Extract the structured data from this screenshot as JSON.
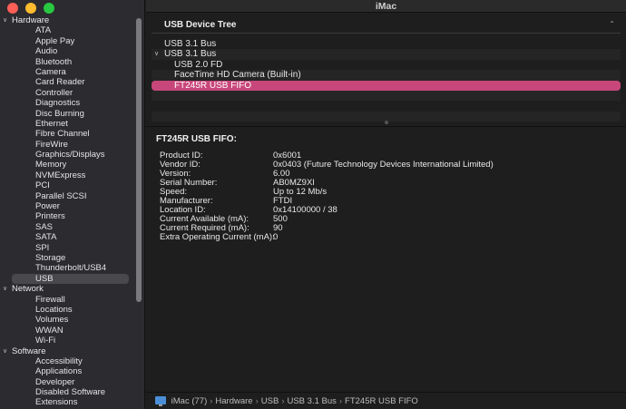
{
  "window": {
    "title": "iMac"
  },
  "sidebar": {
    "rows": [
      {
        "kind": "group",
        "label": "Hardware"
      },
      {
        "kind": "item",
        "label": "ATA"
      },
      {
        "kind": "item",
        "label": "Apple Pay"
      },
      {
        "kind": "item",
        "label": "Audio"
      },
      {
        "kind": "item",
        "label": "Bluetooth"
      },
      {
        "kind": "item",
        "label": "Camera"
      },
      {
        "kind": "item",
        "label": "Card Reader"
      },
      {
        "kind": "item",
        "label": "Controller"
      },
      {
        "kind": "item",
        "label": "Diagnostics"
      },
      {
        "kind": "item",
        "label": "Disc Burning"
      },
      {
        "kind": "item",
        "label": "Ethernet"
      },
      {
        "kind": "item",
        "label": "Fibre Channel"
      },
      {
        "kind": "item",
        "label": "FireWire"
      },
      {
        "kind": "item",
        "label": "Graphics/Displays"
      },
      {
        "kind": "item",
        "label": "Memory"
      },
      {
        "kind": "item",
        "label": "NVMExpress"
      },
      {
        "kind": "item",
        "label": "PCI"
      },
      {
        "kind": "item",
        "label": "Parallel SCSI"
      },
      {
        "kind": "item",
        "label": "Power"
      },
      {
        "kind": "item",
        "label": "Printers"
      },
      {
        "kind": "item",
        "label": "SAS"
      },
      {
        "kind": "item",
        "label": "SATA"
      },
      {
        "kind": "item",
        "label": "SPI"
      },
      {
        "kind": "item",
        "label": "Storage"
      },
      {
        "kind": "item",
        "label": "Thunderbolt/USB4"
      },
      {
        "kind": "item",
        "label": "USB",
        "selected": true
      },
      {
        "kind": "group",
        "label": "Network"
      },
      {
        "kind": "item",
        "label": "Firewall"
      },
      {
        "kind": "item",
        "label": "Locations"
      },
      {
        "kind": "item",
        "label": "Volumes"
      },
      {
        "kind": "item",
        "label": "WWAN"
      },
      {
        "kind": "item",
        "label": "Wi-Fi"
      },
      {
        "kind": "group",
        "label": "Software"
      },
      {
        "kind": "item",
        "label": "Accessibility"
      },
      {
        "kind": "item",
        "label": "Applications"
      },
      {
        "kind": "item",
        "label": "Developer"
      },
      {
        "kind": "item",
        "label": "Disabled Software"
      },
      {
        "kind": "item",
        "label": "Extensions"
      }
    ]
  },
  "tree": {
    "header": "USB Device Tree",
    "rows": [
      {
        "level": 0,
        "label": "USB 3.1 Bus",
        "expanded": false
      },
      {
        "level": 0,
        "label": "USB 3.1 Bus",
        "expanded": true
      },
      {
        "level": 1,
        "label": "USB 2.0 FD"
      },
      {
        "level": 1,
        "label": "FaceTime HD Camera (Built-in)"
      },
      {
        "level": 1,
        "label": "FT245R USB FIFO",
        "selected": true
      }
    ]
  },
  "detail": {
    "title": "FT245R USB FIFO:",
    "properties": [
      {
        "key": "Product ID:",
        "value": "0x6001"
      },
      {
        "key": "Vendor ID:",
        "value": "0x0403  (Future Technology Devices International Limited)"
      },
      {
        "key": "Version:",
        "value": "6.00"
      },
      {
        "key": "Serial Number:",
        "value": "AB0MZ9XI"
      },
      {
        "key": "Speed:",
        "value": "Up to 12 Mb/s"
      },
      {
        "key": "Manufacturer:",
        "value": "FTDI"
      },
      {
        "key": "Location ID:",
        "value": "0x14100000 / 38"
      },
      {
        "key": "Current Available (mA):",
        "value": "500"
      },
      {
        "key": "Current Required (mA):",
        "value": "90"
      },
      {
        "key": "Extra Operating Current (mA):",
        "value": "0"
      }
    ]
  },
  "pathbar": {
    "icon": "imac-icon",
    "segments": [
      "iMac (77)",
      "Hardware",
      "USB",
      "USB 3.1 Bus",
      "FT245R USB FIFO"
    ]
  }
}
